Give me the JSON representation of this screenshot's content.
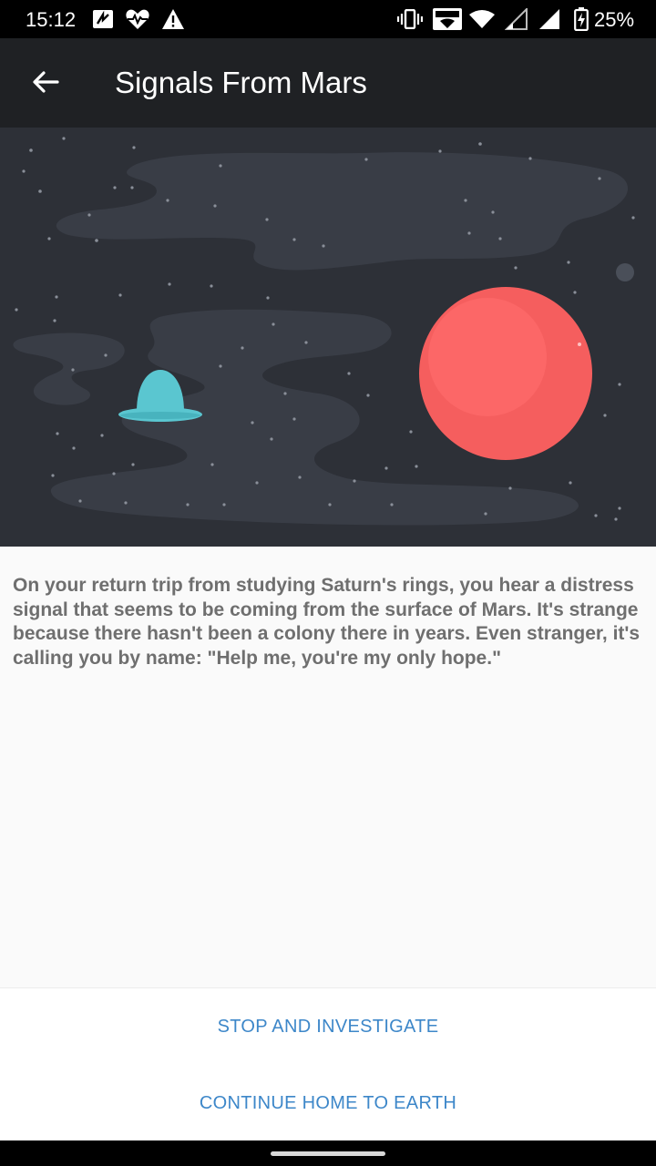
{
  "status_bar": {
    "time": "15:12",
    "battery": "25%",
    "icons": [
      "nfc-icon",
      "health-icon",
      "warning-icon",
      "vibrate-icon",
      "vowifi-icon",
      "wifi-icon",
      "signal-weak-icon",
      "signal-icon",
      "battery-charging-icon"
    ]
  },
  "app_bar": {
    "title": "Signals From Mars",
    "back_icon": "arrow-back-icon"
  },
  "hero": {
    "description_icons": [
      "ufo-icon",
      "mars-planet-icon"
    ],
    "colors": {
      "background": "#2d3037",
      "ufo": "#5ac6d0",
      "planet": "#f55e5e"
    }
  },
  "story": {
    "text": "On your return trip from studying Saturn's rings, you hear a distress signal that seems to be coming from the surface of Mars. It's strange because there hasn't been a colony there in years. Even stranger, it's calling you by name: \"Help me, you're my only hope.\""
  },
  "actions": {
    "investigate_label": "STOP AND INVESTIGATE",
    "continue_label": "CONTINUE HOME TO EARTH"
  },
  "colors": {
    "accent": "#3d87c9"
  }
}
